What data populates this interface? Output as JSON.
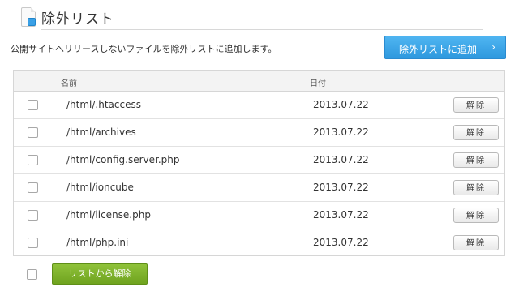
{
  "header": {
    "title": "除外リスト",
    "icon": "document-icon"
  },
  "description": "公開サイトへリリースしないファイルを除外リストに追加します。",
  "add_button": {
    "label": "除外リストに追加",
    "chevron": "›",
    "color": "#3aa6ec"
  },
  "table": {
    "headers": {
      "name": "名前",
      "date": "日付"
    },
    "rows": [
      {
        "path": "/html/.htaccess",
        "date": "2013.07.22",
        "action": "解除"
      },
      {
        "path": "/html/archives",
        "date": "2013.07.22",
        "action": "解除"
      },
      {
        "path": "/html/config.server.php",
        "date": "2013.07.22",
        "action": "解除"
      },
      {
        "path": "/html/ioncube",
        "date": "2013.07.22",
        "action": "解除"
      },
      {
        "path": "/html/license.php",
        "date": "2013.07.22",
        "action": "解除"
      },
      {
        "path": "/html/php.ini",
        "date": "2013.07.22",
        "action": "解除"
      }
    ]
  },
  "remove_button": {
    "label": "リストから解除",
    "color": "#7db42c"
  }
}
